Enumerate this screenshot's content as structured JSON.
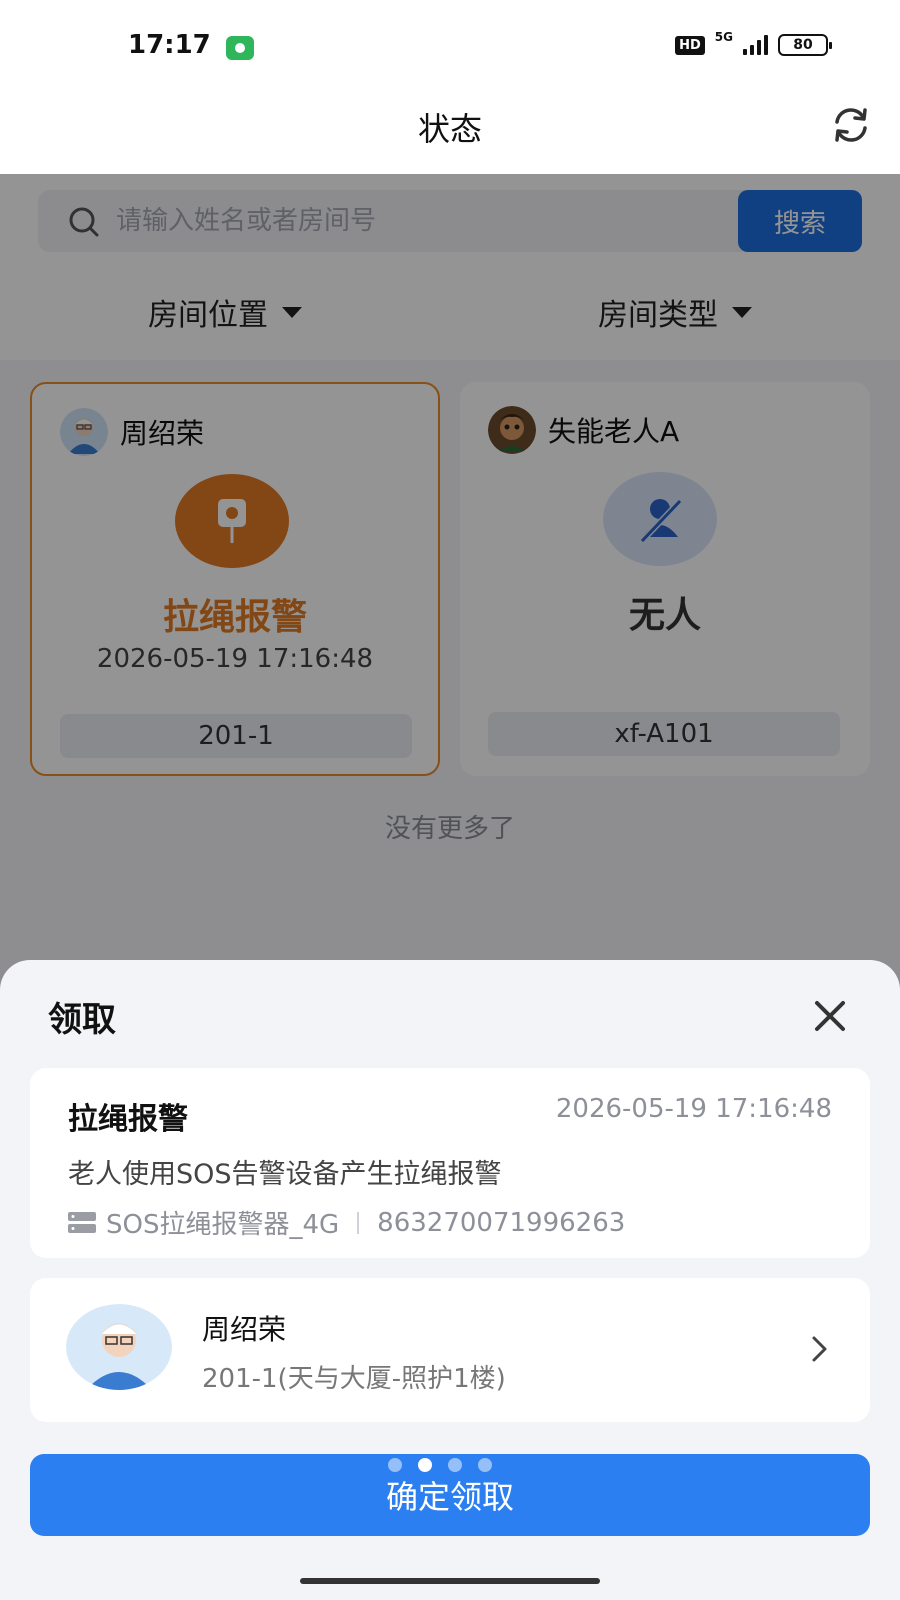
{
  "status_bar": {
    "time": "17:17",
    "hd": "HD",
    "network": "5G",
    "battery": "80"
  },
  "header": {
    "title": "状态",
    "refresh_icon": "refresh-icon"
  },
  "search": {
    "placeholder": "请输入姓名或者房间号",
    "value": "",
    "button_label": "搜索"
  },
  "filters": [
    {
      "label": "房间位置"
    },
    {
      "label": "房间类型"
    }
  ],
  "cards": [
    {
      "name": "周绍荣",
      "status": "拉绳报警",
      "time": "2026-05-19 17:16:48",
      "room": "201-1",
      "status_color": "#e07b24"
    },
    {
      "name": "失能老人A",
      "status": "无人",
      "time": "",
      "room": "xf-A101",
      "status_color": "#333333"
    }
  ],
  "no_more": "没有更多了",
  "sheet": {
    "title": "领取",
    "event": {
      "title": "拉绳报警",
      "time": "2026-05-19 17:16:48",
      "description": "老人使用SOS告警设备产生拉绳报警",
      "device_name": "SOS拉绳报警器_4G",
      "device_id": "863270071996263"
    },
    "person": {
      "name": "周绍荣",
      "room": "201-1(天与大厦-照护1楼)"
    },
    "confirm_label": "确定领取"
  },
  "colors": {
    "primary": "#2b7ff1",
    "alert": "#e07b24",
    "alert_border": "#e88a2a"
  }
}
